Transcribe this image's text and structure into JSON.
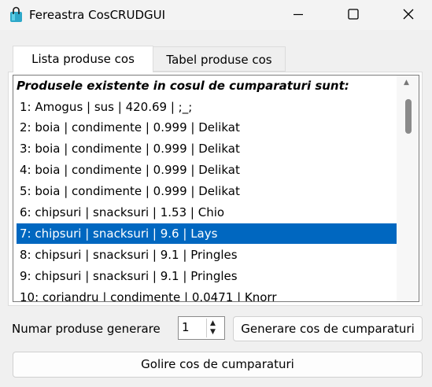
{
  "window": {
    "title": "Fereastra CosCRUDGUI"
  },
  "tabs": [
    {
      "label": "Lista produse cos",
      "active": true
    },
    {
      "label": "Tabel produse cos",
      "active": false
    }
  ],
  "list": {
    "header": "Produsele existente in cosul de cumparaturi sunt:",
    "items": [
      "1: Amogus | sus | 420.69 | ;_;",
      "2: boia | condimente | 0.999 | Delikat",
      "3: boia | condimente | 0.999 | Delikat",
      "4: boia | condimente | 0.999 | Delikat",
      "5: boia | condimente | 0.999 | Delikat",
      "6: chipsuri | snacksuri | 1.53 | Chio",
      "7: chipsuri | snacksuri | 9.6 | Lays",
      "8: chipsuri | snacksuri | 9.1 | Pringles",
      "9: chipsuri | snacksuri | 9.1 | Pringles",
      "10: coriandru | condimente | 0.0471 | Knorr"
    ],
    "selected_index": 6
  },
  "controls": {
    "numar_label": "Numar produse generare",
    "numar_value": "1",
    "generare_button": "Generare cos de cumparaturi",
    "golire_button": "Golire cos de cumparaturi"
  },
  "colors": {
    "selection": "#0067c0",
    "window_bg": "#f0f0f0"
  },
  "icons": {
    "app": "shopping-bag-icon",
    "minimize": "minimize-icon",
    "maximize": "maximize-icon",
    "close": "close-icon"
  }
}
